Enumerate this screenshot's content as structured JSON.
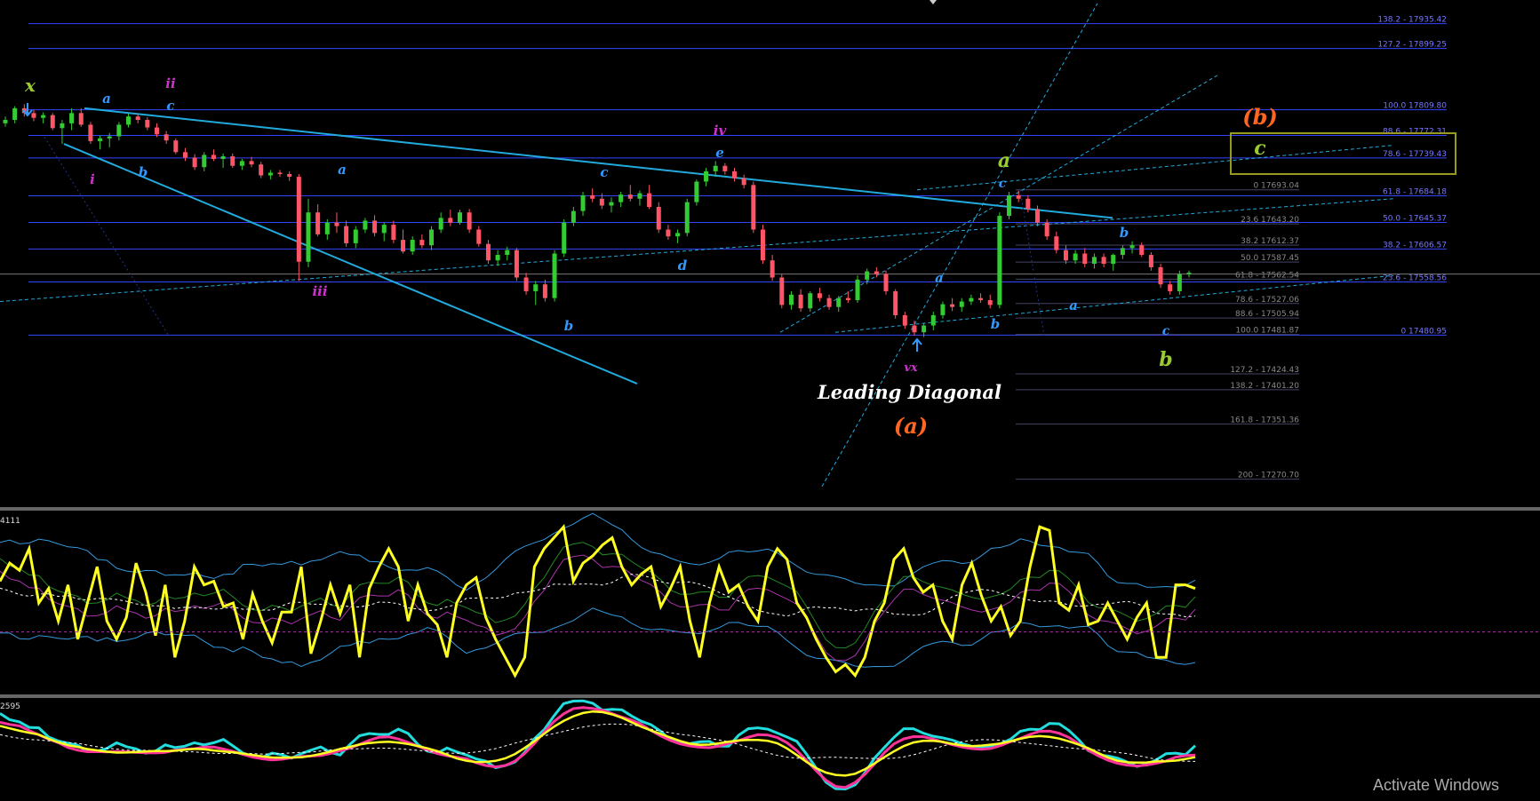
{
  "chart_data": {
    "type": "candlestick",
    "title": "Leading Diagonal",
    "colors": {
      "background": "#000000",
      "bull": "#33cc33",
      "bear": "#ff5566",
      "fib_line": "#3344ff",
      "fib_text": "#7777ff",
      "fib_text_dim": "#888888",
      "trendline": "#22aadd",
      "dotted": "#22aadd",
      "osc_yellow": "#ffff22",
      "osc_pink": "#ff3399",
      "osc_cyan": "#22dddd",
      "osc_white": "#ffffff",
      "osc_blue": "#3399dd",
      "osc_green": "#228822",
      "osc_purple": "#aa33aa",
      "box": "#999922",
      "orange": "#ff6622",
      "green_label": "#99cc33",
      "blue_label": "#3399ff",
      "magenta_label": "#cc33cc",
      "white_label": "#ffffff"
    },
    "price_range": [
      17230,
      17970
    ],
    "fib_levels_right": [
      {
        "ratio": "138.2",
        "price": 17935.42,
        "label": "138.2 - 17935.42"
      },
      {
        "ratio": "127.2",
        "price": 17899.25,
        "label": "127.2 - 17899.25"
      },
      {
        "ratio": "100.0",
        "price": 17809.8,
        "label": "100.0 17809.80"
      },
      {
        "ratio": "88.6",
        "price": 17772.31,
        "label": "88.6 - 17772.31"
      },
      {
        "ratio": "78.6",
        "price": 17739.43,
        "label": "78.6 - 17739.43"
      },
      {
        "ratio": "61.8",
        "price": 17684.18,
        "label": "61.8 - 17684.18"
      },
      {
        "ratio": "50.0",
        "price": 17645.37,
        "label": "50.0 - 17645.37"
      },
      {
        "ratio": "38.2",
        "price": 17606.57,
        "label": "38.2 - 17606.57"
      },
      {
        "ratio": "23.6",
        "price": 17558.56,
        "label": "23.6 - 17558.56"
      },
      {
        "ratio": "0",
        "price": 17480.95,
        "label": "0 17480.95"
      }
    ],
    "fib_levels_mid": [
      {
        "ratio": "0",
        "price": 17693.04,
        "label": "0 17693.04"
      },
      {
        "ratio": "23.6",
        "price": 17643.2,
        "label": "23.6 17643.20"
      },
      {
        "ratio": "38.2",
        "price": 17612.37,
        "label": "38.2 17612.37"
      },
      {
        "ratio": "50.0",
        "price": 17587.45,
        "label": "50.0 17587.45"
      },
      {
        "ratio": "61.8",
        "price": 17562.54,
        "label": "61.8 - 17562.54"
      },
      {
        "ratio": "78.6",
        "price": 17527.06,
        "label": "78.6 - 17527.06"
      },
      {
        "ratio": "88.6",
        "price": 17505.94,
        "label": "88.6 - 17505.94"
      },
      {
        "ratio": "100.0",
        "price": 17481.87,
        "label": "100.0 17481.87"
      },
      {
        "ratio": "127.2",
        "price": 17424.43,
        "label": "127.2 - 17424.43"
      },
      {
        "ratio": "138.2",
        "price": 17401.2,
        "label": "138.2 - 17401.20"
      },
      {
        "ratio": "161.8",
        "price": 17351.36,
        "label": "161.8 - 17351.36"
      },
      {
        "ratio": "200",
        "price": 17270.7,
        "label": "200 - 17270.70"
      }
    ],
    "candles": [
      [
        17790,
        17800,
        17785,
        17795
      ],
      [
        17795,
        17815,
        17790,
        17812
      ],
      [
        17812,
        17818,
        17800,
        17805
      ],
      [
        17805,
        17810,
        17793,
        17798
      ],
      [
        17798,
        17806,
        17790,
        17802
      ],
      [
        17802,
        17805,
        17780,
        17783
      ],
      [
        17783,
        17795,
        17760,
        17790
      ],
      [
        17790,
        17812,
        17780,
        17805
      ],
      [
        17805,
        17812,
        17785,
        17788
      ],
      [
        17788,
        17792,
        17760,
        17764
      ],
      [
        17764,
        17772,
        17752,
        17768
      ],
      [
        17768,
        17776,
        17755,
        17771
      ],
      [
        17771,
        17792,
        17765,
        17788
      ],
      [
        17788,
        17804,
        17784,
        17800
      ],
      [
        17800,
        17804,
        17790,
        17795
      ],
      [
        17795,
        17799,
        17780,
        17784
      ],
      [
        17784,
        17790,
        17770,
        17774
      ],
      [
        17774,
        17779,
        17760,
        17765
      ],
      [
        17765,
        17768,
        17745,
        17748
      ],
      [
        17748,
        17754,
        17735,
        17740
      ],
      [
        17740,
        17745,
        17722,
        17726
      ],
      [
        17726,
        17748,
        17720,
        17744
      ],
      [
        17744,
        17752,
        17735,
        17738
      ],
      [
        17738,
        17746,
        17725,
        17742
      ],
      [
        17742,
        17746,
        17725,
        17728
      ],
      [
        17728,
        17738,
        17722,
        17735
      ],
      [
        17735,
        17741,
        17726,
        17730
      ],
      [
        17730,
        17734,
        17710,
        17714
      ],
      [
        17714,
        17722,
        17708,
        17718
      ],
      [
        17718,
        17722,
        17712,
        17716
      ],
      [
        17716,
        17720,
        17706,
        17712
      ],
      [
        17712,
        17716,
        17560,
        17588
      ],
      [
        17588,
        17680,
        17580,
        17660
      ],
      [
        17660,
        17672,
        17625,
        17628
      ],
      [
        17628,
        17650,
        17620,
        17645
      ],
      [
        17645,
        17660,
        17630,
        17640
      ],
      [
        17640,
        17648,
        17610,
        17615
      ],
      [
        17615,
        17640,
        17608,
        17635
      ],
      [
        17635,
        17652,
        17630,
        17648
      ],
      [
        17648,
        17656,
        17625,
        17630
      ],
      [
        17630,
        17645,
        17618,
        17642
      ],
      [
        17642,
        17648,
        17615,
        17620
      ],
      [
        17620,
        17635,
        17600,
        17603
      ],
      [
        17603,
        17625,
        17598,
        17620
      ],
      [
        17620,
        17628,
        17608,
        17612
      ],
      [
        17612,
        17640,
        17605,
        17635
      ],
      [
        17635,
        17660,
        17630,
        17652
      ],
      [
        17652,
        17664,
        17640,
        17645
      ],
      [
        17645,
        17664,
        17642,
        17660
      ],
      [
        17660,
        17665,
        17630,
        17635
      ],
      [
        17635,
        17640,
        17610,
        17614
      ],
      [
        17614,
        17620,
        17585,
        17590
      ],
      [
        17590,
        17605,
        17582,
        17598
      ],
      [
        17598,
        17610,
        17590,
        17605
      ],
      [
        17605,
        17608,
        17560,
        17565
      ],
      [
        17565,
        17572,
        17540,
        17545
      ],
      [
        17545,
        17560,
        17525,
        17555
      ],
      [
        17555,
        17562,
        17530,
        17535
      ],
      [
        17535,
        17605,
        17530,
        17600
      ],
      [
        17600,
        17650,
        17595,
        17645
      ],
      [
        17645,
        17668,
        17640,
        17662
      ],
      [
        17662,
        17690,
        17655,
        17685
      ],
      [
        17685,
        17695,
        17675,
        17680
      ],
      [
        17680,
        17688,
        17665,
        17670
      ],
      [
        17670,
        17682,
        17660,
        17675
      ],
      [
        17675,
        17690,
        17668,
        17686
      ],
      [
        17686,
        17700,
        17676,
        17680
      ],
      [
        17680,
        17692,
        17670,
        17688
      ],
      [
        17688,
        17700,
        17665,
        17668
      ],
      [
        17668,
        17675,
        17630,
        17635
      ],
      [
        17635,
        17642,
        17620,
        17625
      ],
      [
        17625,
        17635,
        17615,
        17630
      ],
      [
        17630,
        17680,
        17625,
        17675
      ],
      [
        17675,
        17708,
        17670,
        17705
      ],
      [
        17705,
        17725,
        17698,
        17720
      ],
      [
        17720,
        17735,
        17712,
        17728
      ],
      [
        17728,
        17732,
        17715,
        17720
      ],
      [
        17720,
        17725,
        17705,
        17710
      ],
      [
        17710,
        17715,
        17695,
        17700
      ],
      [
        17700,
        17705,
        17630,
        17635
      ],
      [
        17635,
        17642,
        17585,
        17590
      ],
      [
        17590,
        17598,
        17560,
        17565
      ],
      [
        17565,
        17570,
        17520,
        17525
      ],
      [
        17525,
        17545,
        17518,
        17540
      ],
      [
        17540,
        17548,
        17515,
        17520
      ],
      [
        17520,
        17545,
        17515,
        17542
      ],
      [
        17542,
        17550,
        17530,
        17535
      ],
      [
        17535,
        17540,
        17518,
        17522
      ],
      [
        17522,
        17538,
        17515,
        17535
      ],
      [
        17535,
        17545,
        17528,
        17532
      ],
      [
        17532,
        17568,
        17528,
        17562
      ],
      [
        17562,
        17578,
        17555,
        17574
      ],
      [
        17574,
        17580,
        17565,
        17570
      ],
      [
        17570,
        17575,
        17540,
        17545
      ],
      [
        17545,
        17548,
        17505,
        17510
      ],
      [
        17510,
        17515,
        17490,
        17495
      ],
      [
        17495,
        17502,
        17480,
        17485
      ],
      [
        17485,
        17498,
        17478,
        17495
      ],
      [
        17495,
        17515,
        17488,
        17510
      ],
      [
        17510,
        17530,
        17505,
        17526
      ],
      [
        17526,
        17535,
        17516,
        17522
      ],
      [
        17522,
        17535,
        17515,
        17530
      ],
      [
        17530,
        17540,
        17525,
        17535
      ],
      [
        17535,
        17542,
        17528,
        17532
      ],
      [
        17532,
        17540,
        17520,
        17525
      ],
      [
        17525,
        17660,
        17520,
        17655
      ],
      [
        17655,
        17690,
        17650,
        17685
      ],
      [
        17685,
        17692,
        17675,
        17680
      ],
      [
        17680,
        17685,
        17660,
        17665
      ],
      [
        17665,
        17670,
        17640,
        17645
      ],
      [
        17645,
        17650,
        17620,
        17625
      ],
      [
        17625,
        17632,
        17600,
        17605
      ],
      [
        17605,
        17612,
        17585,
        17590
      ],
      [
        17590,
        17605,
        17585,
        17600
      ],
      [
        17600,
        17608,
        17580,
        17585
      ],
      [
        17585,
        17600,
        17578,
        17595
      ],
      [
        17595,
        17600,
        17580,
        17585
      ],
      [
        17585,
        17600,
        17575,
        17598
      ],
      [
        17598,
        17612,
        17592,
        17608
      ],
      [
        17608,
        17618,
        17600,
        17612
      ],
      [
        17612,
        17616,
        17595,
        17598
      ],
      [
        17598,
        17602,
        17575,
        17580
      ],
      [
        17580,
        17585,
        17550,
        17555
      ],
      [
        17555,
        17560,
        17540,
        17545
      ],
      [
        17545,
        17575,
        17540,
        17570
      ],
      [
        17570,
        17575,
        17565,
        17572
      ]
    ],
    "trendlines": [
      {
        "type": "solid",
        "from": [
          95,
          17812
        ],
        "to": [
          1252,
          17652
        ]
      },
      {
        "type": "solid",
        "from": [
          72,
          17760
        ],
        "to": [
          717,
          17410
        ]
      },
      {
        "type": "dashed",
        "from": [
          0,
          17530
        ],
        "to": [
          1568,
          17680
        ]
      },
      {
        "type": "dashed",
        "from": [
          940,
          17485
        ],
        "to": [
          1568,
          17568
        ]
      },
      {
        "type": "dashed",
        "from": [
          878,
          17485
        ],
        "to": [
          1370,
          17860
        ]
      },
      {
        "type": "dashed",
        "from": [
          925,
          17260
        ],
        "to": [
          1235,
          17965
        ]
      },
      {
        "type": "dashed",
        "from": [
          1032,
          17693
        ],
        "to": [
          1568,
          17758
        ]
      }
    ],
    "wave_labels": [
      {
        "text": "x",
        "color": "green_label",
        "size": 20
      },
      {
        "text": "a",
        "color": "blue_label",
        "size": 15
      },
      {
        "text": "ii",
        "color": "magenta_label",
        "size": 15
      },
      {
        "text": "c",
        "color": "blue_label",
        "size": 15
      },
      {
        "text": "i",
        "color": "magenta_label",
        "size": 15
      },
      {
        "text": "b",
        "color": "blue_label",
        "size": 15
      },
      {
        "text": "a",
        "color": "blue_label",
        "size": 15
      },
      {
        "text": "iii",
        "color": "magenta_label",
        "size": 15
      },
      {
        "text": "c",
        "color": "blue_label",
        "size": 15
      },
      {
        "text": "b",
        "color": "blue_label",
        "size": 15
      },
      {
        "text": "d",
        "color": "blue_label",
        "size": 15
      },
      {
        "text": "iv",
        "color": "magenta_label",
        "size": 15
      },
      {
        "text": "e",
        "color": "blue_label",
        "size": 15
      },
      {
        "text": "vx",
        "color": "magenta_label",
        "size": 13
      },
      {
        "text": "a",
        "color": "blue_label",
        "size": 15
      },
      {
        "text": "b",
        "color": "blue_label",
        "size": 15
      },
      {
        "text": "a",
        "color": "green_label",
        "size": 22
      },
      {
        "text": "c",
        "color": "blue_label",
        "size": 14
      },
      {
        "text": "b",
        "color": "blue_label",
        "size": 15
      },
      {
        "text": "a",
        "color": "blue_label",
        "size": 15
      },
      {
        "text": "c",
        "color": "blue_label",
        "size": 14
      },
      {
        "text": "b",
        "color": "green_label",
        "size": 22
      },
      {
        "text": "(b)",
        "color": "orange",
        "size": 24
      },
      {
        "text": "c",
        "color": "green_label",
        "size": 22
      },
      {
        "text": "(a)",
        "color": "orange",
        "size": 24
      }
    ],
    "oscillator1": {
      "label": "4111",
      "yellow": [
        62,
        72,
        68,
        80,
        50,
        58,
        40,
        60,
        30,
        50,
        70,
        40,
        30,
        42,
        72,
        56,
        32,
        60,
        20,
        40,
        70,
        60,
        62,
        48,
        50,
        30,
        55,
        40,
        28,
        45,
        45,
        70,
        22,
        40,
        60,
        44,
        60,
        20,
        58,
        70,
        80,
        70,
        40,
        60,
        44,
        38,
        20,
        50,
        60,
        64,
        42,
        30,
        20,
        10,
        20,
        70,
        80,
        86,
        92,
        62,
        72,
        76,
        82,
        86,
        70,
        60,
        66,
        70,
        48,
        58,
        70,
        40,
        20,
        50,
        70,
        56,
        60,
        48,
        40,
        70,
        80,
        74,
        50,
        42,
        30,
        20,
        12,
        16,
        10,
        20,
        40,
        50,
        74,
        80,
        64,
        56,
        60,
        40,
        30,
        60,
        72,
        54,
        40,
        48,
        32,
        40,
        70,
        92,
        90,
        50,
        46,
        60,
        38,
        40,
        50,
        40,
        30,
        42,
        50,
        20,
        20,
        60,
        60,
        58
      ],
      "ref_line_value": 34
    },
    "oscillator2": {
      "label": "2595",
      "ref_line_value": 50
    },
    "watermark": "Activate Windows"
  }
}
